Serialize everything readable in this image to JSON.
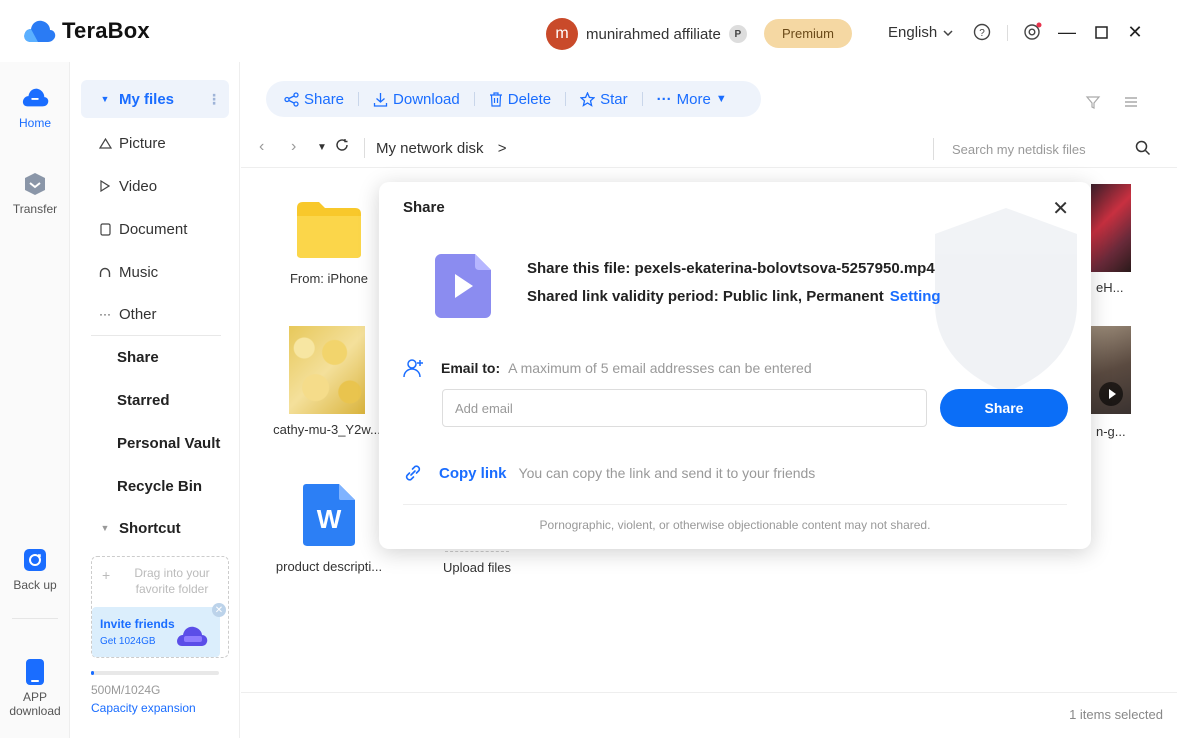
{
  "app": {
    "title": "TeraBox",
    "brand_color": "#1a6dff"
  },
  "titlebar": {
    "avatar_letter": "m",
    "username": "munirahmed affiliate",
    "badge": "P",
    "premium_label": "Premium",
    "language": "English",
    "icons": [
      "help-icon",
      "settings-icon",
      "minimize-icon",
      "maximize-icon",
      "close-icon"
    ]
  },
  "rail": {
    "items": [
      {
        "label": "Home",
        "icon": "home-cloud-icon"
      },
      {
        "label": "Transfer",
        "icon": "transfer-icon"
      },
      {
        "label": "Back up",
        "icon": "backup-icon"
      },
      {
        "label_line1": "APP",
        "label_line2": "download",
        "icon": "phone-icon"
      }
    ]
  },
  "sidebar": {
    "my_files": "My files",
    "items": [
      {
        "label": "Picture",
        "icon": "triangle-icon"
      },
      {
        "label": "Video",
        "icon": "play-icon"
      },
      {
        "label": "Document",
        "icon": "document-icon"
      },
      {
        "label": "Music",
        "icon": "headphones-icon"
      },
      {
        "label": "Other",
        "icon": "more-icon"
      }
    ],
    "bold_items": [
      "Share",
      "Starred",
      "Personal Vault",
      "Recycle Bin"
    ],
    "shortcut": "Shortcut",
    "drag_text": "Drag into your favorite folder",
    "invite_title": "Invite friends",
    "invite_sub": "Get 1024GB",
    "capacity_used_fraction": 0.005,
    "capacity_text": "500M/1024G",
    "capacity_link": "Capacity expansion"
  },
  "toolbar": {
    "share": "Share",
    "download": "Download",
    "delete": "Delete",
    "star": "Star",
    "more": "More"
  },
  "nav": {
    "breadcrumb": "My network disk",
    "breadcrumb_arrow": ">",
    "search_placeholder": "Search my netdisk files"
  },
  "files": [
    {
      "name": "From: iPhone",
      "type": "folder"
    },
    {
      "name": "cathy-mu-3_Y2w...",
      "type": "image"
    },
    {
      "name": "product descripti...",
      "type": "word"
    },
    {
      "name": "Upload files",
      "type": "upload"
    }
  ],
  "peek_labels": [
    "eH...",
    "n-g..."
  ],
  "status": "1 items selected",
  "modal": {
    "title": "Share",
    "file_line": "Share this file: pexels-ekaterina-bolovtsova-5257950.mp4",
    "validity_line": "Shared link validity period: Public link, Permanent",
    "setting": "Setting",
    "email_label": "Email to:",
    "email_hint": "A maximum of 5 email addresses can be entered",
    "email_placeholder": "Add email",
    "share_button": "Share",
    "copy_label": "Copy link",
    "copy_hint": "You can copy the link and send it to your friends",
    "footer": "Pornographic, violent, or otherwise objectionable content may not shared."
  }
}
